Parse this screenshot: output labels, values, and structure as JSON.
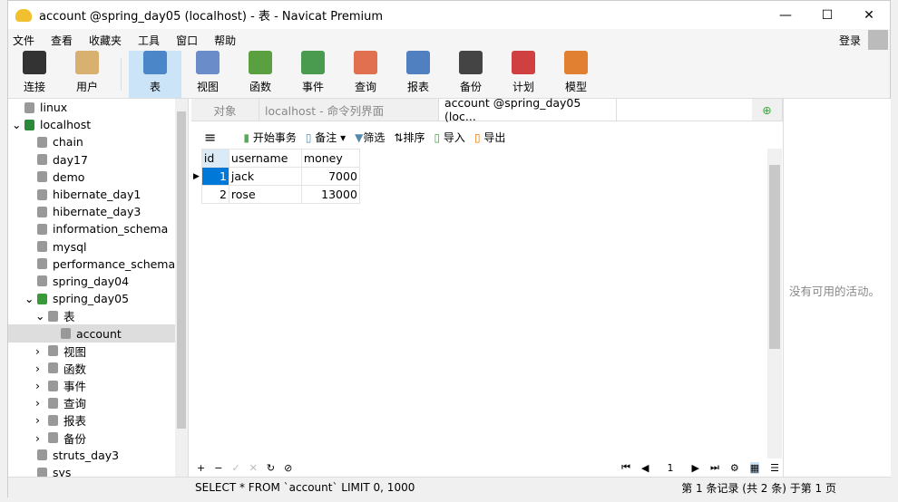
{
  "window": {
    "title": "account @spring_day05 (localhost) - 表 - Navicat Premium",
    "min": "—",
    "max": "☐",
    "close": "✕"
  },
  "menu": [
    "文件",
    "查看",
    "收藏夹",
    "工具",
    "窗口",
    "帮助"
  ],
  "login": "登录",
  "toolbar": [
    {
      "label": "连接",
      "icon": "connection-icon",
      "color": "#333333"
    },
    {
      "label": "用户",
      "icon": "user-icon",
      "color": "#d8b070"
    },
    {
      "label": "表",
      "icon": "table-icon",
      "color": "#4a86c8",
      "active": true
    },
    {
      "label": "视图",
      "icon": "view-icon",
      "color": "#6a8cc8"
    },
    {
      "label": "函数",
      "icon": "function-icon",
      "color": "#5aa040"
    },
    {
      "label": "事件",
      "icon": "event-icon",
      "color": "#4a9a50"
    },
    {
      "label": "查询",
      "icon": "query-icon",
      "color": "#e07050"
    },
    {
      "label": "报表",
      "icon": "report-icon",
      "color": "#5080c0"
    },
    {
      "label": "备份",
      "icon": "backup-icon",
      "color": "#444444"
    },
    {
      "label": "计划",
      "icon": "schedule-icon",
      "color": "#d04040"
    },
    {
      "label": "模型",
      "icon": "model-icon",
      "color": "#e08030"
    }
  ],
  "sidebar": [
    {
      "label": "linux",
      "level": 0,
      "arrow": ""
    },
    {
      "label": "localhost",
      "level": 0,
      "arrow": "⌄",
      "color": "#2a8a3a"
    },
    {
      "label": "chain",
      "level": 1
    },
    {
      "label": "day17",
      "level": 1
    },
    {
      "label": "demo",
      "level": 1
    },
    {
      "label": "hibernate_day1",
      "level": 1
    },
    {
      "label": "hibernate_day3",
      "level": 1
    },
    {
      "label": "information_schema",
      "level": 1
    },
    {
      "label": "mysql",
      "level": 1
    },
    {
      "label": "performance_schema",
      "level": 1
    },
    {
      "label": "spring_day04",
      "level": 1
    },
    {
      "label": "spring_day05",
      "level": 1,
      "arrow": "⌄",
      "color": "#3a9a3a"
    },
    {
      "label": "表",
      "level": 2,
      "arrow": "⌄"
    },
    {
      "label": "account",
      "level": 3,
      "selected": true
    },
    {
      "label": "视图",
      "level": 2,
      "arrow": "›"
    },
    {
      "label": "函数",
      "level": 2,
      "arrow": "›"
    },
    {
      "label": "事件",
      "level": 2,
      "arrow": "›"
    },
    {
      "label": "查询",
      "level": 2,
      "arrow": "›"
    },
    {
      "label": "报表",
      "level": 2,
      "arrow": "›"
    },
    {
      "label": "备份",
      "level": 2,
      "arrow": "›"
    },
    {
      "label": "struts_day3",
      "level": 1
    },
    {
      "label": "sys",
      "level": 1
    }
  ],
  "tabs": [
    {
      "label": "对象"
    },
    {
      "label": "localhost - 命令列界面"
    },
    {
      "label": "account @spring_day05 (loc...",
      "active": true
    }
  ],
  "subtoolbar": {
    "menu": "≡",
    "begin": "开始事务",
    "note": "备注",
    "filter": "筛选",
    "sort": "排序",
    "import": "导入",
    "export": "导出"
  },
  "table": {
    "columns": [
      "id",
      "username",
      "money"
    ],
    "rows": [
      [
        "1",
        "jack",
        "7000"
      ],
      [
        "2",
        "rose",
        "13000"
      ]
    ]
  },
  "right_panel": {
    "message": "没有可用的活动。"
  },
  "nav": {
    "buttons": [
      "+",
      "−",
      "✓",
      "✕",
      "↻",
      "⊘"
    ],
    "page": "1"
  },
  "status": {
    "sql": "SELECT * FROM `account` LIMIT 0, 1000",
    "record": "第 1 条记录 (共 2 条) 于第 1 页"
  }
}
